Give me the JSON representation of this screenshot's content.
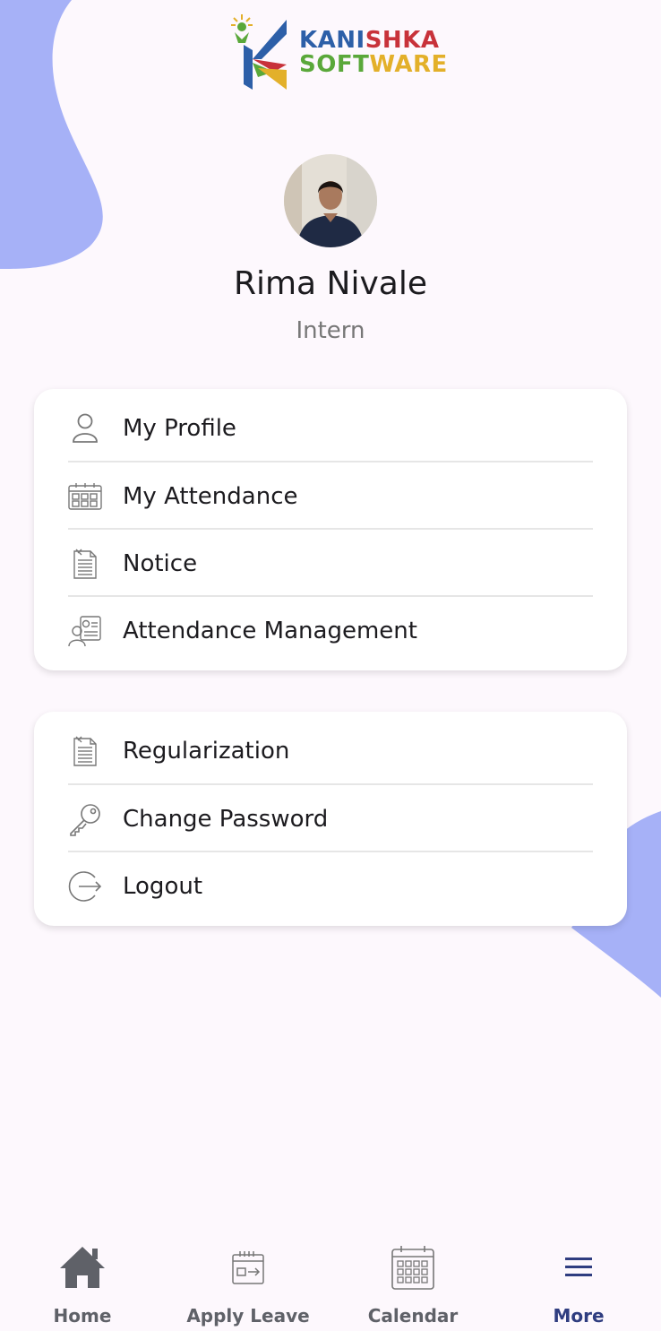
{
  "brand": {
    "line1": "KANISHKA",
    "line2": "SOFTWARE"
  },
  "profile": {
    "name": "Rima Nivale",
    "role": "Intern"
  },
  "menu_primary": [
    {
      "label": "My Profile",
      "icon": "user-icon"
    },
    {
      "label": "My Attendance",
      "icon": "calendar-grid-icon"
    },
    {
      "label": "Notice",
      "icon": "notice-document-icon"
    },
    {
      "label": "Attendance Management",
      "icon": "attendance-management-icon"
    }
  ],
  "menu_secondary": [
    {
      "label": "Regularization",
      "icon": "regularization-document-icon"
    },
    {
      "label": "Change Password",
      "icon": "key-icon"
    },
    {
      "label": "Logout",
      "icon": "logout-icon"
    }
  ],
  "bottom_nav": [
    {
      "label": "Home",
      "icon": "home-icon",
      "active": false
    },
    {
      "label": "Apply Leave",
      "icon": "apply-leave-icon",
      "active": false
    },
    {
      "label": "Calendar",
      "icon": "calendar-icon",
      "active": false
    },
    {
      "label": "More",
      "icon": "hamburger-menu-icon",
      "active": true
    }
  ],
  "colors": {
    "background": "#fdf8fd",
    "blob": "#a6b1f7",
    "active_nav": "#2f3d80",
    "inactive_nav": "#5f6168"
  }
}
